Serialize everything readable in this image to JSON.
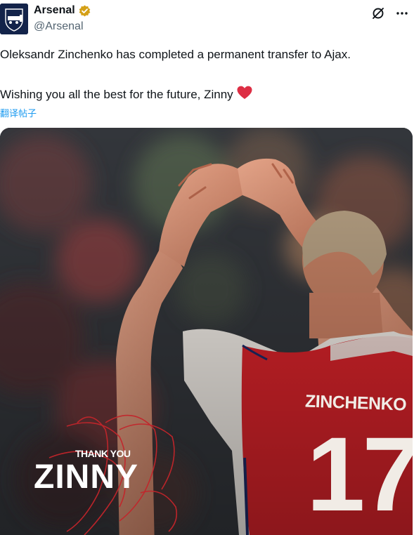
{
  "account": {
    "name": "Arsenal",
    "handle": "@Arsenal",
    "avatar_icon": "arsenal-crest-icon",
    "verified_icon": "verified-badge-icon",
    "verified_color": "#d4a017"
  },
  "header_actions": {
    "grok_icon": "grok-icon",
    "more_icon": "more-options-icon"
  },
  "tweet": {
    "line1": "Oleksandr Zinchenko has completed a permanent transfer to Ajax.",
    "line2": "Wishing you all the best for the future, Zinny",
    "emoji_icon": "red-heart-icon",
    "translate_label": "翻译帖子"
  },
  "image": {
    "thank_you": "THANK YOU",
    "title": "ZINNY",
    "jersey_name": "ZINCHENKO",
    "jersey_number": "17",
    "colors": {
      "jersey_red": "#d8232a",
      "jersey_white": "#f1ece6",
      "link_blue": "#1d9bf0"
    }
  }
}
